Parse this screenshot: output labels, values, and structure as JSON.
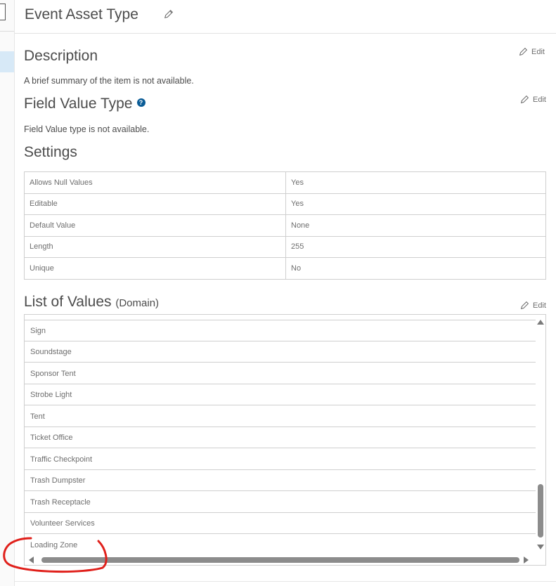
{
  "header": {
    "title": "Event Asset Type"
  },
  "description": {
    "heading": "Description",
    "text": "A brief summary of the item is not available.",
    "edit_label": "Edit"
  },
  "field_value_type": {
    "heading": "Field Value Type",
    "help_glyph": "?",
    "text": "Field Value type is not available.",
    "edit_label": "Edit"
  },
  "settings": {
    "heading": "Settings",
    "rows": [
      {
        "label": "Allows Null Values",
        "value": "Yes"
      },
      {
        "label": "Editable",
        "value": "Yes"
      },
      {
        "label": "Default Value",
        "value": "None"
      },
      {
        "label": "Length",
        "value": "255"
      },
      {
        "label": "Unique",
        "value": "No"
      }
    ]
  },
  "domain": {
    "heading": "List of Values",
    "subheading": "(Domain)",
    "edit_label": "Edit",
    "items": [
      "Sign",
      "Soundstage",
      "Sponsor Tent",
      "Strobe Light",
      "Tent",
      "Ticket Office",
      "Traffic Checkpoint",
      "Trash Dumpster",
      "Trash Receptacle",
      "Volunteer Services",
      "Loading Zone"
    ]
  },
  "colors": {
    "annotation": "#e0201b",
    "help_icon": "#0a5c96",
    "selection_highlight": "#d7e9f7"
  }
}
